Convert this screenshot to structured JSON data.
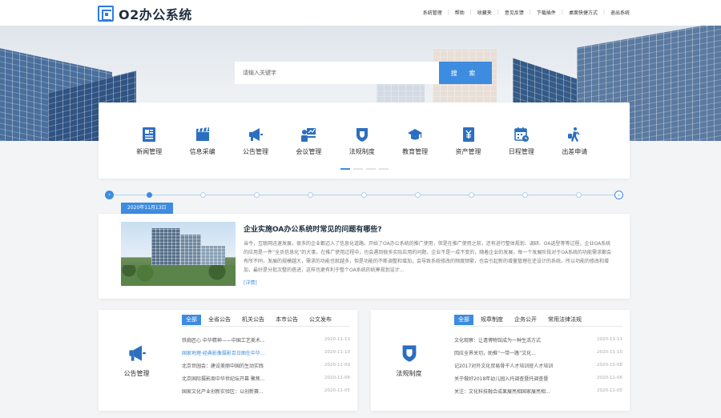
{
  "header": {
    "logo_text": "O2办公系统",
    "nav": [
      "系统管理",
      "帮助",
      "收藏夹",
      "意见反馈",
      "下载插件",
      "桌面快捷方式",
      "退出系统"
    ]
  },
  "search": {
    "placeholder": "请输入关键字",
    "button_label": "搜 索"
  },
  "modules": [
    {
      "label": "新闻管理",
      "icon": "news-icon"
    },
    {
      "label": "信息采编",
      "icon": "clapperboard-icon"
    },
    {
      "label": "公告管理",
      "icon": "megaphone-icon"
    },
    {
      "label": "会议管理",
      "icon": "meeting-icon"
    },
    {
      "label": "法规制度",
      "icon": "shield-icon"
    },
    {
      "label": "教育管理",
      "icon": "graduation-cap-icon"
    },
    {
      "label": "资产管理",
      "icon": "yen-book-icon"
    },
    {
      "label": "日程管理",
      "icon": "calendar-icon"
    },
    {
      "label": "出差申请",
      "icon": "traveler-icon"
    }
  ],
  "timeline": {
    "date": "2020年11月13日",
    "article_title": "企业实施OA办公系统时常见的问题有哪些?",
    "article_body": "当今，互联网迅速发展，很多的企业都迈入了信息化道路。开始了OA办公系统的推广使用，但是在推广使用之前，还有进行整体规划、调研、OA选型等等过程，企业OA系统的应用是一件“全员信息化”的大事，在推广使用过程中，也会遇到很多实际应用的问题。企业不是一成不变的，随着企业的发展，每一个发展阶段对于OA系统的功能需求都会有所不同，发展的规模越大，需求的功能也就越多，但是功能的不断调整和增加，会导致系统修改的频度频繁，也会引起新的增量管理在还设计的系统。所以功能的修改和增加，最好是分批次整的搭进，这样也更有利于整个OA系统的统筹规划设计...",
    "more_label": "[详情]"
  },
  "panels": [
    {
      "title": "公告管理",
      "icon": "megaphone-icon",
      "tabs": [
        "全部",
        "全省公告",
        "机关公告",
        "本市公告",
        "公文发布"
      ],
      "rows": [
        {
          "title": "铁肩匠心 中华精神——中国工艺美术...",
          "date": "2020-11-11",
          "highlight": false
        },
        {
          "title": "国家地理·经典影像摄影百日图在中华...",
          "date": "2020-11-10",
          "highlight": true
        },
        {
          "title": "北京世园会：建设美丽中国的生动实践",
          "date": "2020-11-09",
          "highlight": false
        },
        {
          "title": "北京国际摄影周中华世纪坛开幕 聚焦...",
          "date": "2020-11-06",
          "highlight": false
        },
        {
          "title": "国家文化产业创新实验区：以创新赛...",
          "date": "2020-11-05",
          "highlight": false
        }
      ]
    },
    {
      "title": "法规制度",
      "icon": "shield-icon",
      "tabs": [
        "全部",
        "规章制度",
        "企务公开",
        "常用法律法规"
      ],
      "rows": [
        {
          "title": "文化观察：让遗博物馆成为一种生活方式",
          "date": "2020-11-11",
          "highlight": false
        },
        {
          "title": "回应全界关切，助推“一带一路”文化...",
          "date": "2020-11-10",
          "highlight": false
        },
        {
          "title": "记2017对外文化贸易骨干人才培训班人才培训",
          "date": "2020-11-08",
          "highlight": false
        },
        {
          "title": "关于做好2018年幼儿园入托调查暨托调查暨",
          "date": "2020-11-06",
          "highlight": false
        },
        {
          "title": "关注：文化科技融合成果展亮相国家展亮相...",
          "date": "2020-11-05",
          "highlight": false
        }
      ]
    }
  ],
  "colors": {
    "accent": "#3d8ce0",
    "title": "#1f2d3d"
  }
}
